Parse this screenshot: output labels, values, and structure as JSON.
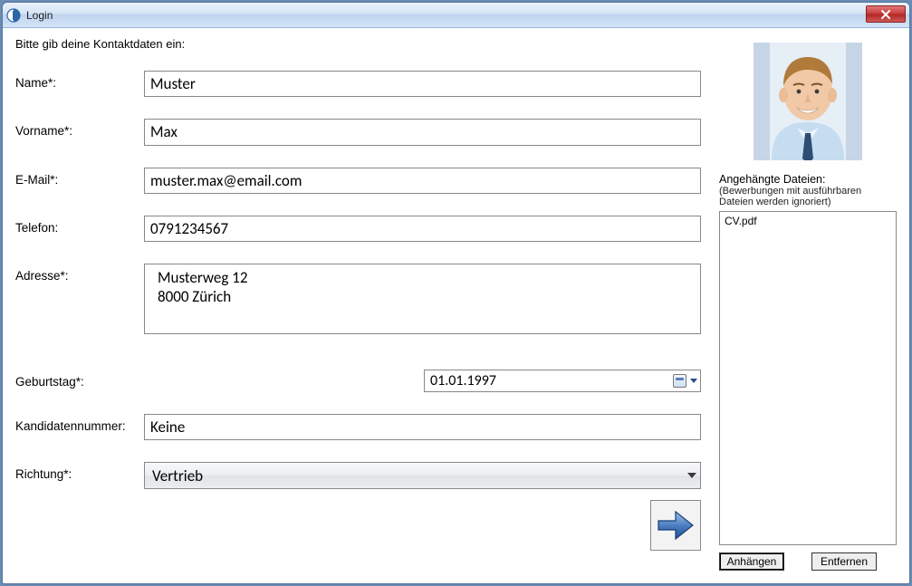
{
  "window": {
    "title": "Login"
  },
  "instruction": "Bitte gib deine Kontaktdaten ein:",
  "labels": {
    "name": "Name*:",
    "vorname": "Vorname*:",
    "email": "E-Mail*:",
    "telefon": "Telefon:",
    "adresse": "Adresse*:",
    "geburtstag": "Geburtstag*:",
    "kandidatennummer": "Kandidatennummer:",
    "richtung": "Richtung*:"
  },
  "values": {
    "name": "Muster",
    "vorname": "Max",
    "email": "muster.max@email.com",
    "telefon": "0791234567",
    "adresse": "Musterweg 12\n8000 Zürich",
    "geburtstag": "01.01.1997",
    "kandidatennummer": "Keine",
    "richtung": "Vertrieb"
  },
  "attachments": {
    "heading": "Angehängte Dateien:",
    "note": "(Bewerbungen mit ausführbaren Dateien werden ignoriert)",
    "items": [
      "CV.pdf"
    ],
    "attach_label": "Anhängen",
    "remove_label": "Entfernen"
  }
}
